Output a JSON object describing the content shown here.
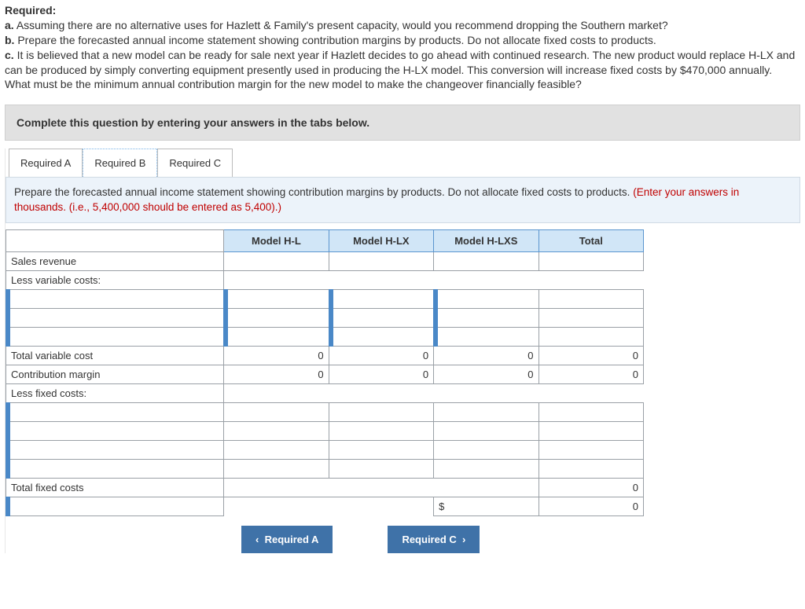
{
  "question": {
    "heading": "Required:",
    "a_label": "a.",
    "a_text": "Assuming there are no alternative uses for Hazlett & Family's present capacity, would you recommend dropping the Southern market?",
    "b_label": "b.",
    "b_text": "Prepare the forecasted annual income statement showing contribution margins by products. Do not allocate fixed costs to products.",
    "c_label": "c.",
    "c_text": "It is believed that a new model can be ready for sale next year if Hazlett decides to go ahead with continued research. The new product would replace H-LX and can be produced by simply converting equipment presently used in producing the H-LX model. This conversion will increase fixed costs by $470,000 annually. What must be the minimum annual contribution margin for the new model to make the changeover financially feasible?"
  },
  "instruction_bar": "Complete this question by entering your answers in the tabs below.",
  "tabs": {
    "a": "Required A",
    "b": "Required B",
    "c": "Required C"
  },
  "pane": {
    "prompt_main": "Prepare the forecasted annual income statement showing contribution margins by products. Do not allocate fixed costs to products.",
    "prompt_red": "(Enter your answers in thousands. (i.e., 5,400,000 should be entered as 5,400).)"
  },
  "table": {
    "headers": {
      "col1": "Model H-L",
      "col2": "Model H-LX",
      "col3": "Model H-LXS",
      "col4": "Total"
    },
    "rows": {
      "sales": "Sales revenue",
      "less_var": "Less variable costs:",
      "total_var": "Total variable cost",
      "contrib": "Contribution margin",
      "less_fixed": "Less fixed costs:",
      "total_fixed": "Total fixed costs"
    },
    "values": {
      "total_var": {
        "c1": "0",
        "c2": "0",
        "c3": "0",
        "c4": "0"
      },
      "contrib": {
        "c1": "0",
        "c2": "0",
        "c3": "0",
        "c4": "0"
      },
      "total_fixed": {
        "c4": "0"
      },
      "last": {
        "currency": "$",
        "c4": "0"
      }
    }
  },
  "nav": {
    "prev_chev": "‹",
    "prev": "Required A",
    "next": "Required C",
    "next_chev": "›"
  }
}
